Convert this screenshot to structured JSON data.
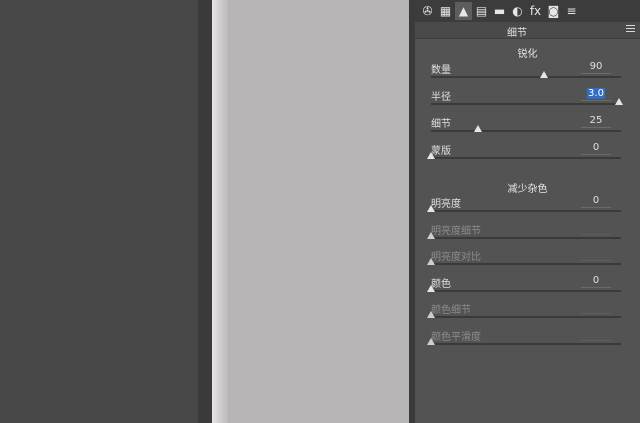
{
  "panel_tabs": [
    {
      "icon": "aperture-icon",
      "glyph": "✇"
    },
    {
      "icon": "histogram-icon",
      "glyph": "▦"
    },
    {
      "icon": "detail-triangle-icon",
      "glyph": "▲"
    },
    {
      "icon": "hsl-icon",
      "glyph": "▤"
    },
    {
      "icon": "split-tone-icon",
      "glyph": "▬"
    },
    {
      "icon": "lens-correction-icon",
      "glyph": "◐"
    },
    {
      "icon": "fx-icon",
      "glyph": "fx"
    },
    {
      "icon": "camera-icon",
      "glyph": "◙"
    },
    {
      "icon": "presets-sliders-icon",
      "glyph": "≡"
    }
  ],
  "panel": {
    "title": "细节"
  },
  "sharpening": {
    "title": "锐化",
    "rows": [
      {
        "label": "数量",
        "value": "90",
        "level": 0.6
      },
      {
        "label": "半径",
        "value": "3.0",
        "level": 1.0,
        "selected": true
      },
      {
        "label": "细节",
        "value": "25",
        "level": 0.25
      },
      {
        "label": "蒙版",
        "value": "0",
        "level": 0.0
      }
    ]
  },
  "noise_reduction": {
    "title": "减少杂色",
    "rows": [
      {
        "label": "明亮度",
        "value": "0",
        "level": 0.0
      },
      {
        "label": "明亮度细节",
        "value": "",
        "level": 0.0,
        "disabled": true
      },
      {
        "label": "明亮度对比",
        "value": "",
        "level": 0.0,
        "disabled": true
      },
      {
        "label": "颜色",
        "value": "0",
        "level": 0.0
      },
      {
        "label": "颜色细节",
        "value": "",
        "level": 0.0,
        "disabled": true
      },
      {
        "label": "颜色平滑度",
        "value": "",
        "level": 0.0,
        "disabled": true
      }
    ]
  }
}
